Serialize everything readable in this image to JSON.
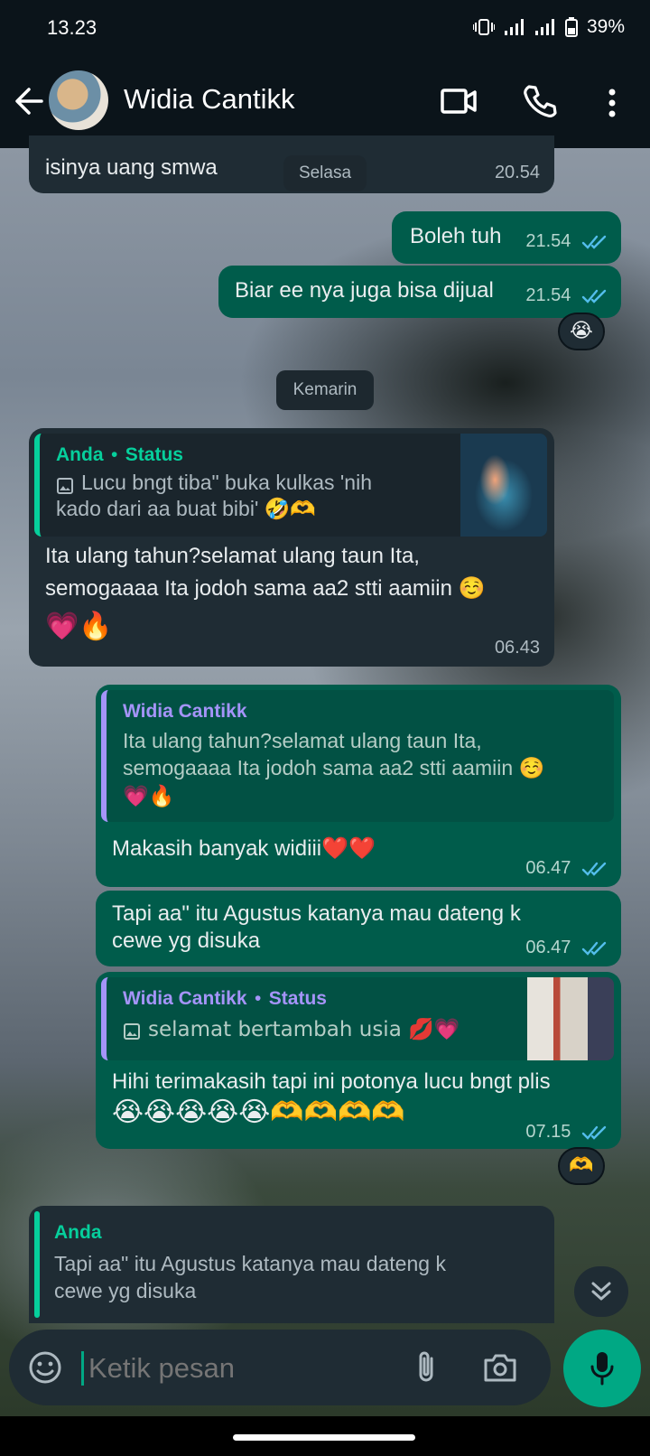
{
  "status": {
    "time": "13.23",
    "battery": "39%"
  },
  "header": {
    "contact_name": "Widia Cantikk"
  },
  "colors": {
    "accent": "#00a884",
    "outgoing": "#005c4b",
    "incoming": "#1f2c34",
    "tick_blue": "#53bdeb"
  },
  "messages": {
    "m0": {
      "text": "isinya uang smwa",
      "time": "20.54"
    },
    "date_pill_top": "Selasa",
    "m1": {
      "text": "Boleh tuh",
      "time": "21.54"
    },
    "m2": {
      "text": "Biar ee nya juga bisa dijual",
      "time": "21.54",
      "reaction": "😭"
    },
    "date_pill": "Kemarin",
    "m3": {
      "quote_author": "Anda",
      "quote_sep": "•",
      "quote_source": "Status",
      "quote_text": "Lucu bngt tiba\" buka kulkas 'nih kado dari aa buat bibi' 🤣🫶",
      "text_line1": "Ita ulang tahun?selamat ulang taun Ita,",
      "text_line2": "semogaaaa Ita jodoh sama aa2 stti aamiin ☺️",
      "text_line3": "💗🔥",
      "time": "06.43"
    },
    "m4": {
      "quote_author": "Widia Cantikk",
      "quote_line1": "Ita ulang tahun?selamat ulang taun Ita,",
      "quote_line2": "semogaaaa Ita jodoh sama aa2 stti aamiin ☺️",
      "quote_line3": "💗🔥",
      "text": "Makasih banyak widiii❤️❤️",
      "time": "06.47"
    },
    "m5": {
      "text_line1": "Tapi aa\" itu Agustus katanya mau dateng k",
      "text_line2": "cewe yg disuka",
      "time": "06.47"
    },
    "m6": {
      "quote_author": "Widia Cantikk",
      "quote_sep": "•",
      "quote_source": "Status",
      "quote_text": "selamat bertambah usia 💋💗",
      "text_line1": "Hihi terimakasih tapi ini potonya lucu bngt plis",
      "text_line2": "😭😭😭😭😭🫶🫶🫶🫶",
      "time": "07.15",
      "reaction": "🫶"
    }
  },
  "reply": {
    "author": "Anda",
    "line1": "Tapi aa\" itu Agustus katanya mau dateng k",
    "line2": "cewe yg disuka"
  },
  "composer": {
    "placeholder": "Ketik pesan"
  },
  "icons": [
    "back-arrow-icon",
    "video-call-icon",
    "phone-icon",
    "more-vert-icon",
    "emoji-icon",
    "attach-icon",
    "camera-icon",
    "mic-icon",
    "chevron-double-down-icon",
    "image-icon",
    "double-check-icon"
  ]
}
